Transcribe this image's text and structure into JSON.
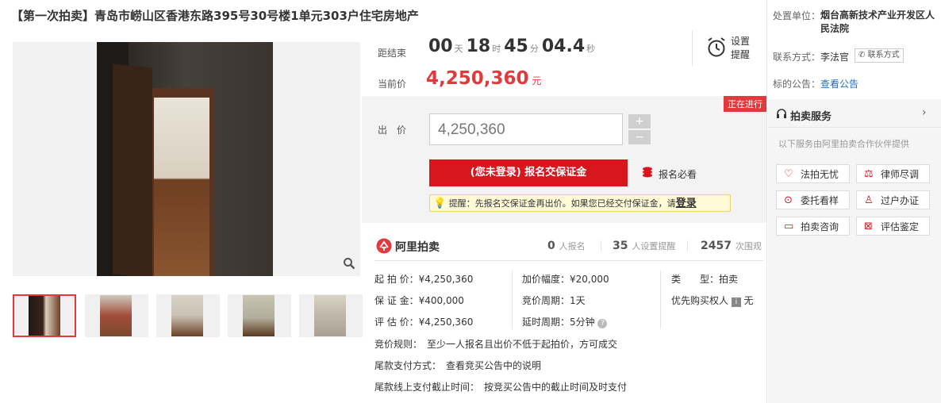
{
  "title": "【第一次拍卖】青岛市崂山区香港东路395号30号楼1单元303户住宅房地产",
  "countdown": {
    "label": "距结束",
    "days": "00",
    "days_unit": "天",
    "hours": "18",
    "hours_unit": "时",
    "minutes": "45",
    "minutes_unit": "分",
    "seconds": "04.4",
    "seconds_unit": "秒"
  },
  "reminder": {
    "line1": "设置",
    "line2": "提醒"
  },
  "current_price": {
    "label": "当前价",
    "value": "4,250,360",
    "unit": "元"
  },
  "status_badge": "正在进行",
  "bid": {
    "label": "出　价",
    "value": "4,250,360",
    "plus": "+",
    "minus": "−"
  },
  "signup_button": "(您未登录) 报名交保证金",
  "must_read": "报名必看",
  "tip": {
    "text": "提醒：先报名交保证金再出价。如果您已经交付保证金，请",
    "login": "登录"
  },
  "brand": "阿里拍卖",
  "stats": {
    "signed_num": "0",
    "signed_label": "人报名",
    "reminders_num": "35",
    "reminders_label": "人设置提醒",
    "views_num": "2457",
    "views_label": "次围观"
  },
  "details": {
    "start_price": "起 拍 价：¥4,250,360",
    "deposit": "保 证 金：¥400,000",
    "appraisal": "评 估 价：¥4,250,360",
    "increment": "加价幅度：¥20,000",
    "cycle": "竞价周期：1天",
    "delay": "延时周期：5分钟",
    "type_label": "类　　型：",
    "type_value": "拍卖",
    "priority_label": "优先购买权人",
    "priority_value": "无",
    "rule": "竞价规则：　至少一人报名且出价不低于起拍价，方可成交",
    "final_payment": "尾款支付方式：　查看竞买公告中的说明",
    "deadline": "尾款线上支付截止时间：　按竞买公告中的截止时间及时支付"
  },
  "sidebar": {
    "unit_label": "处置单位：",
    "unit_value_1": "烟台高新技术产业开发区人",
    "unit_value_2": "民法院",
    "contact_label": "联系方式：",
    "contact_value": "李法官",
    "contact_button": "联系方式",
    "notice_label": "标的公告：",
    "notice_link": "查看公告",
    "service_title": "拍卖服务",
    "service_sub": "以下服务由阿里拍卖合作伙伴提供",
    "services": [
      "法拍无忧",
      "律师尽调",
      "委托看样",
      "过户办证",
      "拍卖咨询",
      "评估鉴定"
    ]
  },
  "colors": {
    "accent": "#e4393c",
    "button": "#d7161e",
    "link": "#1f6fbd"
  }
}
